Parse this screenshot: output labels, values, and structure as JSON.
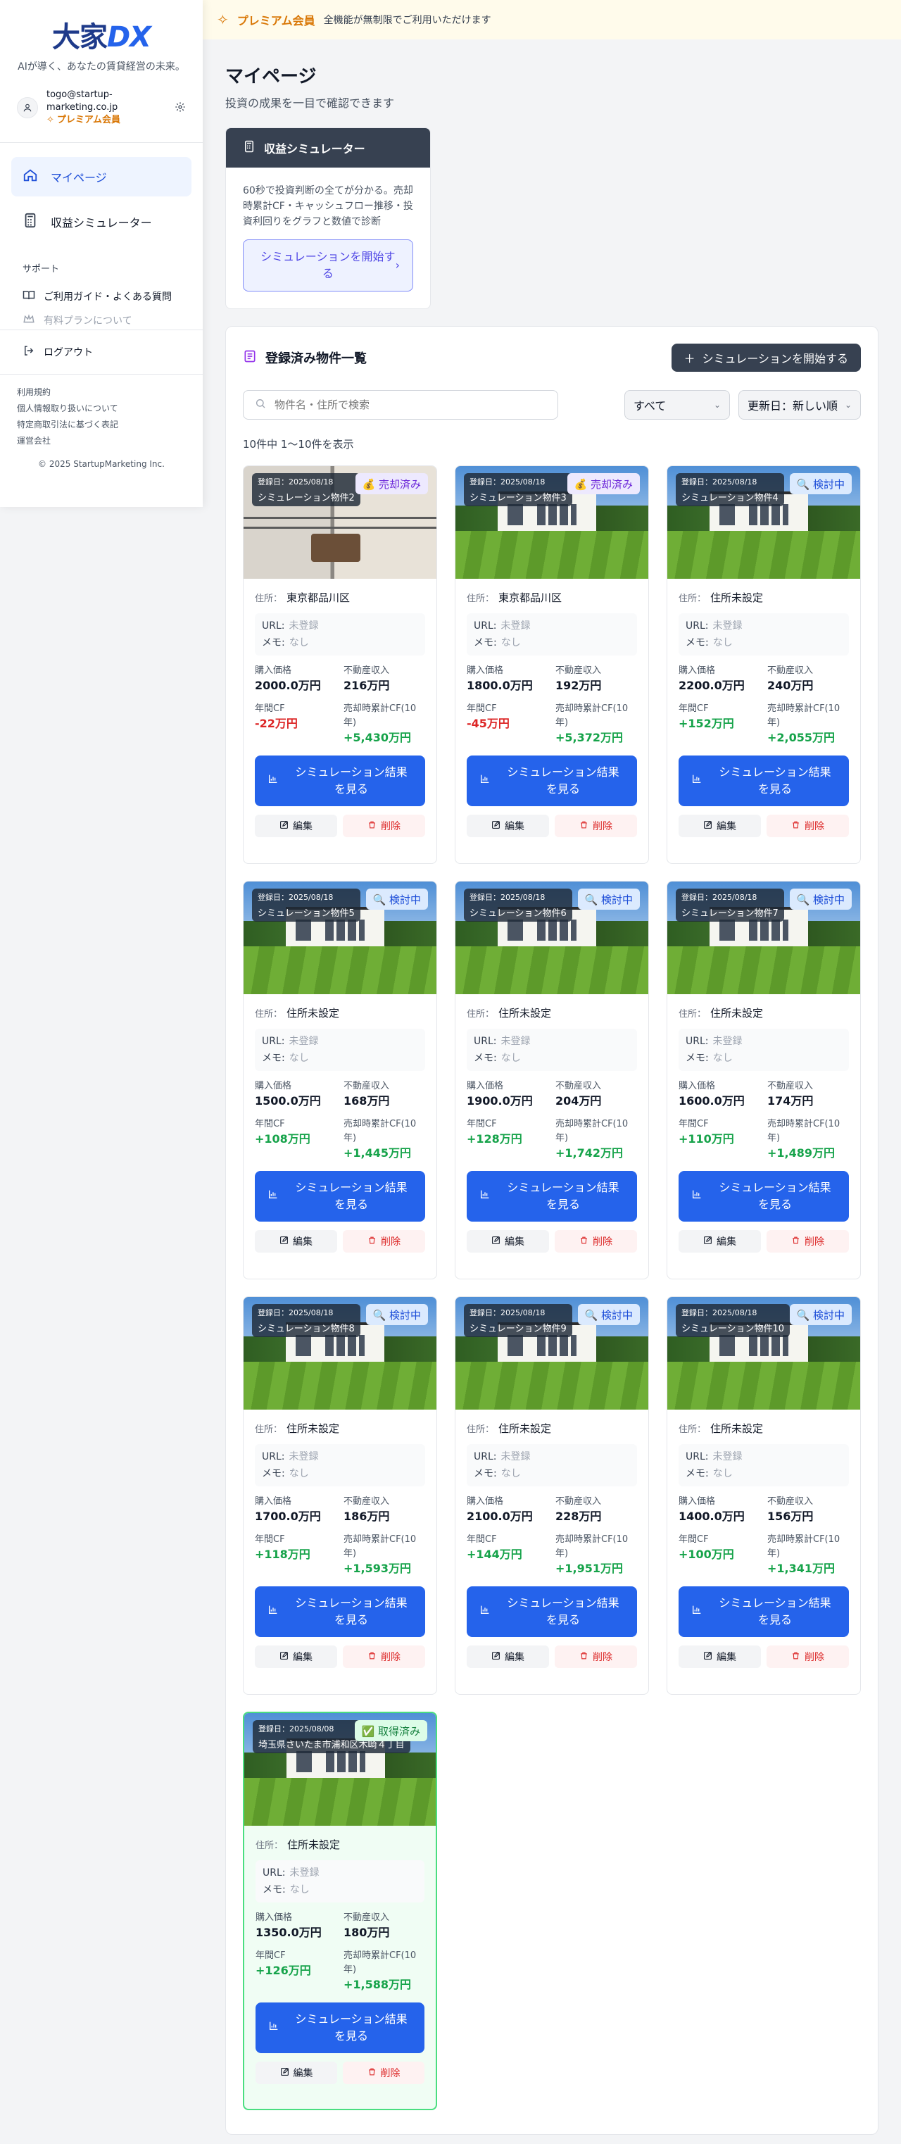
{
  "sidebar": {
    "logo_main": "大家",
    "logo_accent": "DX",
    "tagline": "AIが導く、あなたの賃貸経営の未来。",
    "user_email": "togo@startup-marketing.co.jp",
    "premium_label": "プレミアム会員",
    "nav": [
      {
        "label": "マイページ",
        "icon": "home-icon"
      },
      {
        "label": "収益シミュレーター",
        "icon": "calculator-icon"
      }
    ],
    "support_label": "サポート",
    "support_items": [
      {
        "label": "ご利用ガイド・よくある質問",
        "icon": "book-icon"
      },
      {
        "label": "有料プランについて",
        "icon": "crown-icon"
      }
    ],
    "logout_label": "ログアウト",
    "legal": [
      "利用規約",
      "個人情報取り扱いについて",
      "特定商取引法に基づく表記",
      "運営会社"
    ],
    "copyright": "© 2025 StartupMarketing Inc."
  },
  "banner": {
    "title": "プレミアム会員",
    "desc": "全機能が無制限でご利用いただけます"
  },
  "page": {
    "title": "マイページ",
    "subtitle": "投資の成果を一目で確認できます"
  },
  "simulator_card": {
    "title": "収益シミュレーター",
    "desc": "60秒で投資判断の全てが分かる。売却時累計CF・キャッシュフロー推移・投資利回りをグラフと数値で診断",
    "button": "シミュレーションを開始する"
  },
  "properties": {
    "title": "登録済み物件一覧",
    "start_button": "シミュレーションを開始する",
    "search_placeholder": "物件名・住所で検索",
    "filter_value": "すべて",
    "sort_value": "更新日：新しい順",
    "count_text": "10件中 1〜10件を表示",
    "labels": {
      "address": "住所：",
      "url": "URL:",
      "memo": "メモ:",
      "price": "購入価格",
      "income": "不動産収入",
      "annual_cf": "年間CF",
      "sale_cf": "売却時累計CF(10年)",
      "result_button": "シミュレーション結果を見る",
      "edit": "編集",
      "delete": "削除"
    },
    "items": [
      {
        "date": "登録日：2025/08/18",
        "name": "シミュレーション物件2",
        "status": "💰 売却済み",
        "status_type": "sold",
        "address": "東京都品川区",
        "url": "未登録",
        "memo": "なし",
        "price": "2000.0万円",
        "income": "216万円",
        "annual_cf": "-22万円",
        "cf_sign": "neg",
        "sale_cf": "+5,430万円",
        "image": "balcony"
      },
      {
        "date": "登録日：2025/08/18",
        "name": "シミュレーション物件3",
        "status": "💰 売却済み",
        "status_type": "sold",
        "address": "東京都品川区",
        "url": "未登録",
        "memo": "なし",
        "price": "1800.0万円",
        "income": "192万円",
        "annual_cf": "-45万円",
        "cf_sign": "neg",
        "sale_cf": "+5,372万円",
        "image": "house"
      },
      {
        "date": "登録日：2025/08/18",
        "name": "シミュレーション物件4",
        "status": "🔍 検討中",
        "status_type": "review",
        "address": "住所未設定",
        "url": "未登録",
        "memo": "なし",
        "price": "2200.0万円",
        "income": "240万円",
        "annual_cf": "+152万円",
        "cf_sign": "pos",
        "sale_cf": "+2,055万円",
        "image": "house"
      },
      {
        "date": "登録日：2025/08/18",
        "name": "シミュレーション物件5",
        "status": "🔍 検討中",
        "status_type": "review",
        "address": "住所未設定",
        "url": "未登録",
        "memo": "なし",
        "price": "1500.0万円",
        "income": "168万円",
        "annual_cf": "+108万円",
        "cf_sign": "pos",
        "sale_cf": "+1,445万円",
        "image": "house"
      },
      {
        "date": "登録日：2025/08/18",
        "name": "シミュレーション物件6",
        "status": "🔍 検討中",
        "status_type": "review",
        "address": "住所未設定",
        "url": "未登録",
        "memo": "なし",
        "price": "1900.0万円",
        "income": "204万円",
        "annual_cf": "+128万円",
        "cf_sign": "pos",
        "sale_cf": "+1,742万円",
        "image": "house"
      },
      {
        "date": "登録日：2025/08/18",
        "name": "シミュレーション物件7",
        "status": "🔍 検討中",
        "status_type": "review",
        "address": "住所未設定",
        "url": "未登録",
        "memo": "なし",
        "price": "1600.0万円",
        "income": "174万円",
        "annual_cf": "+110万円",
        "cf_sign": "pos",
        "sale_cf": "+1,489万円",
        "image": "house"
      },
      {
        "date": "登録日：2025/08/18",
        "name": "シミュレーション物件8",
        "status": "🔍 検討中",
        "status_type": "review",
        "address": "住所未設定",
        "url": "未登録",
        "memo": "なし",
        "price": "1700.0万円",
        "income": "186万円",
        "annual_cf": "+118万円",
        "cf_sign": "pos",
        "sale_cf": "+1,593万円",
        "image": "house"
      },
      {
        "date": "登録日：2025/08/18",
        "name": "シミュレーション物件9",
        "status": "🔍 検討中",
        "status_type": "review",
        "address": "住所未設定",
        "url": "未登録",
        "memo": "なし",
        "price": "2100.0万円",
        "income": "228万円",
        "annual_cf": "+144万円",
        "cf_sign": "pos",
        "sale_cf": "+1,951万円",
        "image": "house"
      },
      {
        "date": "登録日：2025/08/18",
        "name": "シミュレーション物件10",
        "status": "🔍 検討中",
        "status_type": "review",
        "address": "住所未設定",
        "url": "未登録",
        "memo": "なし",
        "price": "1400.0万円",
        "income": "156万円",
        "annual_cf": "+100万円",
        "cf_sign": "pos",
        "sale_cf": "+1,341万円",
        "image": "house"
      },
      {
        "date": "登録日：2025/08/08",
        "name": "埼玉県さいたま市浦和区木崎４丁目",
        "status": "✅ 取得済み",
        "status_type": "acquired",
        "address": "住所未設定",
        "url": "未登録",
        "memo": "なし",
        "price": "1350.0万円",
        "income": "180万円",
        "annual_cf": "+126万円",
        "cf_sign": "pos",
        "sale_cf": "+1,588万円",
        "image": "house"
      }
    ]
  },
  "colors": {
    "primary": "#2563eb",
    "premium": "#d97706",
    "positive": "#16a34a",
    "negative": "#dc2626",
    "dark": "#374151"
  }
}
